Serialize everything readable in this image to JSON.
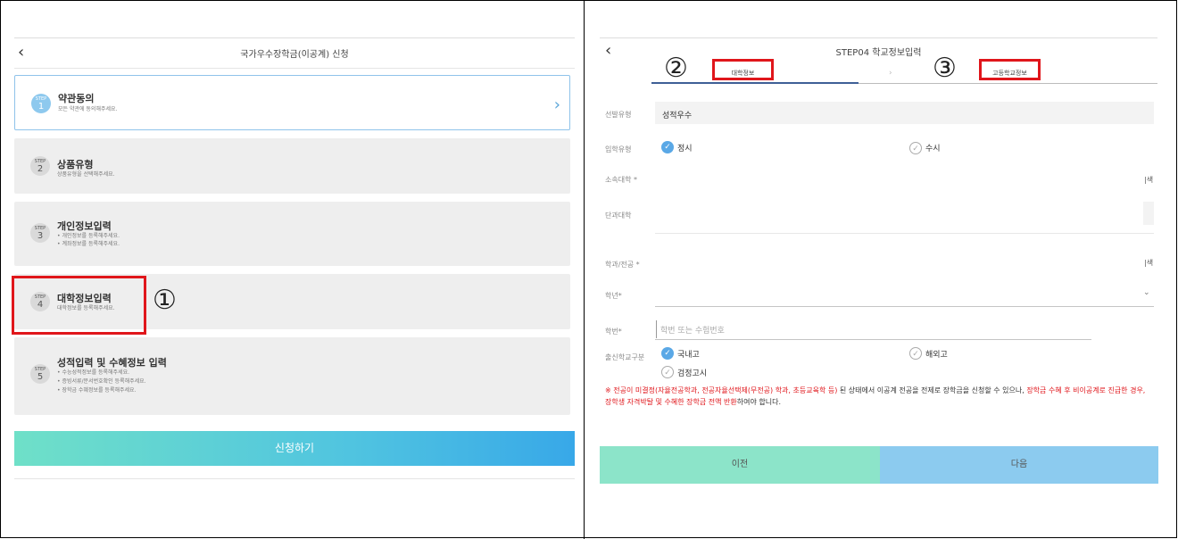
{
  "left": {
    "title": "국가우수장학금(이공계) 신청",
    "back_icon": "‹",
    "steps": [
      {
        "step_word": "STEP",
        "num": "1",
        "title": "약관동의",
        "subs": [
          "모든 약관에 동의해주세요."
        ]
      },
      {
        "step_word": "STEP",
        "num": "2",
        "title": "상품유형",
        "subs": [
          "상품유형을 선택해주세요."
        ]
      },
      {
        "step_word": "STEP",
        "num": "3",
        "title": "개인정보입력",
        "subs": [
          "• 개인정보를 등록해주세요.",
          "• 계좌정보를 등록해주세요."
        ]
      },
      {
        "step_word": "STEP",
        "num": "4",
        "title": "대학정보입력",
        "subs": [
          "대학정보를 등록해주세요."
        ]
      },
      {
        "step_word": "STEP",
        "num": "5",
        "title": "성적입력 및 수혜정보 입력",
        "subs": [
          "• 수능성적정보를 등록해주세요.",
          "• 증빙서류/문서번호확인 등록해주세요.",
          "• 장학금 수혜정보를 등록해주세요."
        ]
      }
    ],
    "apply_label": "신청하기",
    "marker1": "①"
  },
  "right": {
    "title": "STEP04 학교정보입력",
    "back_icon": "‹",
    "tab_univ": "대학정보",
    "tab_sep": "›",
    "tab_high": "고등학교정보",
    "marker2": "②",
    "marker3": "③",
    "labels": {
      "selection_type": "선발유형",
      "admission_type": "입학유형",
      "university": "소속대학 *",
      "college": "단과대학",
      "department": "학과/전공 *",
      "grade": "학년*",
      "student_id": "학번*",
      "hs_type": "출신학교구분"
    },
    "selection_value": "성적우수",
    "admission_opt1": "정시",
    "admission_opt2": "수시",
    "search_label": "검색",
    "search_label_partial": "|색",
    "grade_arrow": "⌄",
    "student_id_placeholder": "학번 또는 수험번호",
    "hs_opt1": "국내고",
    "hs_opt2": "해외고",
    "hs_opt3": "검정고시",
    "notice_prefix": "※ 전공이 미결정(자율전공학과, 전공자율선택제(무전공) 학과, 초등교육학 등)",
    "notice_middle": " 된 상태에서 이공계 전공을 전제로 장학금을 신청할 수 있으나,",
    "notice_red2": " 장학금 수혜 후 비이공계로 진급한 경우, 장학생 자격박탈 및 수혜한 장학금 전액 반환",
    "notice_suffix": "하여야 합니다.",
    "prev_label": "이전",
    "next_label": "다음"
  }
}
